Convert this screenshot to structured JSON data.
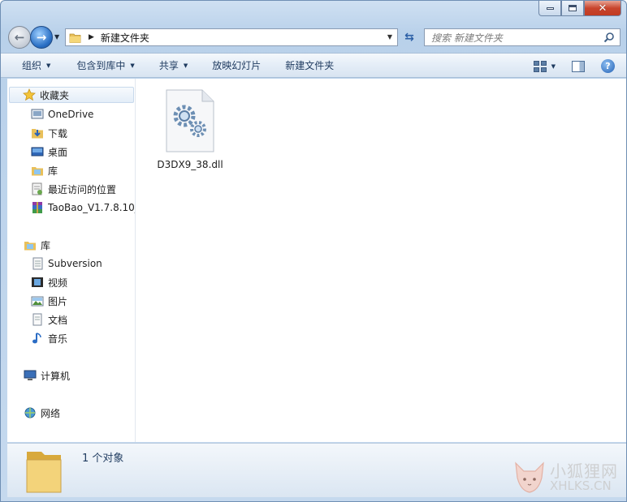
{
  "window": {
    "caption_buttons": [
      "minimize",
      "maximize",
      "close"
    ]
  },
  "navbar": {
    "address_path": "新建文件夹",
    "search_placeholder": "搜索 新建文件夹"
  },
  "toolbar": {
    "organize": "组织",
    "include_in_library": "包含到库中",
    "share": "共享",
    "slideshow": "放映幻灯片",
    "new_folder": "新建文件夹"
  },
  "sidebar": {
    "favorites": {
      "label": "收藏夹",
      "items": [
        {
          "label": "OneDrive",
          "icon": "onedrive-icon"
        },
        {
          "label": "下载",
          "icon": "download-folder-icon"
        },
        {
          "label": "桌面",
          "icon": "desktop-icon"
        },
        {
          "label": "库",
          "icon": "library-icon"
        },
        {
          "label": "最近访问的位置",
          "icon": "recent-places-icon"
        },
        {
          "label": "TaoBao_V1.7.8.10_",
          "icon": "winrar-archive-icon"
        }
      ]
    },
    "libraries": {
      "label": "库",
      "items": [
        {
          "label": "Subversion",
          "icon": "document-library-icon"
        },
        {
          "label": "视频",
          "icon": "video-icon"
        },
        {
          "label": "图片",
          "icon": "picture-icon"
        },
        {
          "label": "文档",
          "icon": "document-icon"
        },
        {
          "label": "音乐",
          "icon": "music-icon"
        }
      ]
    },
    "computer": {
      "label": "计算机",
      "icon": "computer-icon"
    },
    "network": {
      "label": "网络",
      "icon": "network-icon"
    }
  },
  "files": [
    {
      "name": "D3DX9_38.dll",
      "icon": "dll-file-icon"
    }
  ],
  "details": {
    "count_text": "1 个对象"
  },
  "watermark": {
    "cn": "小狐狸网",
    "en": "XHLKS.CN"
  },
  "colors": {
    "frame": "#c5d9ee",
    "toolbar_text": "#1e3a5f",
    "selection": "#e3edf8"
  }
}
